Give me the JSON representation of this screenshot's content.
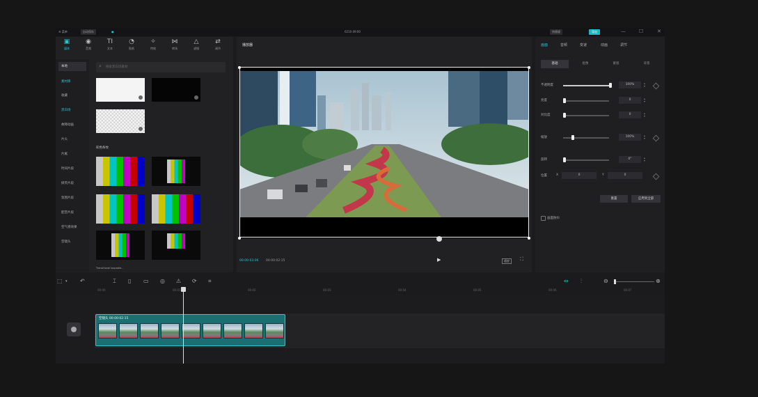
{
  "titlebar": {
    "menu": "☰ 菜单",
    "autosave": "自动保存",
    "project_name": "0210 09:00",
    "shortcut_btn": "快捷键",
    "export_btn": "导出",
    "min": "—",
    "max": "☐",
    "close": "✕"
  },
  "media": {
    "tools": [
      {
        "icon": "▣",
        "label": "媒体"
      },
      {
        "icon": "◉",
        "label": "音频"
      },
      {
        "icon": "TI",
        "label": "文本"
      },
      {
        "icon": "◔",
        "label": "贴纸"
      },
      {
        "icon": "✧",
        "label": "特效"
      },
      {
        "icon": "⋈",
        "label": "转场"
      },
      {
        "icon": "△",
        "label": "滤镜"
      },
      {
        "icon": "⇄",
        "label": "调节"
      }
    ],
    "categories": [
      "本地",
      "素材库",
      "收藏",
      "黑白场",
      "故障动画",
      "片头",
      "片尾",
      "时间片段",
      "搞笑片段",
      "氛围片段",
      "配音片段",
      "空气感效果",
      "空镜头"
    ],
    "search_placeholder": "搜索黑白场素材",
    "section_label": "彩色条纹",
    "caption": "Transitional loopable..."
  },
  "player": {
    "title": "播放器",
    "current_time": "00:00:03:06",
    "total_time": "00:00:02:15",
    "ratio_btn": "适应"
  },
  "properties": {
    "tabs": [
      "画面",
      "音频",
      "变速",
      "动画",
      "调节"
    ],
    "subtabs": [
      "基础",
      "抠像",
      "蒙版",
      "背景"
    ],
    "rows": [
      {
        "label": "不透明度",
        "value": "100%"
      },
      {
        "label": "亮度",
        "value": "0"
      },
      {
        "label": "对比度",
        "value": "0"
      },
      {
        "label": "缩放",
        "value": "100%"
      },
      {
        "label": "旋转",
        "value": "0°"
      }
    ],
    "position_label": "位置",
    "pos_x": "0",
    "pos_y": "0",
    "reset_btn": "重置",
    "apply_all_btn": "应用到全部",
    "smart_label": "画面防抖"
  },
  "timeline": {
    "ruler": [
      "00:00",
      "00:01",
      "00:02",
      "00:03",
      "00:04",
      "00:05",
      "00:06",
      "00:07"
    ],
    "clip_label": "空镜头  00:00:02:15"
  },
  "colors": {
    "accent": "#23c4d4",
    "clip": "#1b6e72"
  }
}
